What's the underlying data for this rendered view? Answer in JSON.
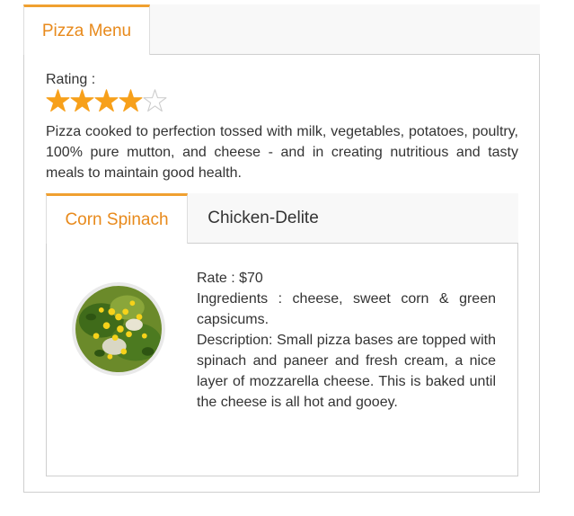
{
  "outer_tabs": [
    {
      "label": "Pizza Menu",
      "active": true
    }
  ],
  "rating": {
    "label": "Rating :",
    "value": 4,
    "max": 5
  },
  "intro": "Pizza cooked to perfection tossed with milk, vegetables, potatoes, poultry, 100% pure mutton, and cheese - and in creating nutritious and tasty meals to maintain good health.",
  "inner_tabs": [
    {
      "label": "Corn Spinach",
      "active": true
    },
    {
      "label": "Chicken-Delite",
      "active": false
    }
  ],
  "item": {
    "rate": "Rate : $70",
    "ingredients": "Ingredients : cheese, sweet corn & green capsicums.",
    "description": "Description: Small pizza bases are topped with spinach and paneer and fresh cream, a nice layer of mozzarella cheese. This is baked until the cheese is all hot and gooey."
  },
  "colors": {
    "accent": "#f0a030",
    "star_fill": "#f7a01a",
    "star_empty": "#cccccc"
  }
}
